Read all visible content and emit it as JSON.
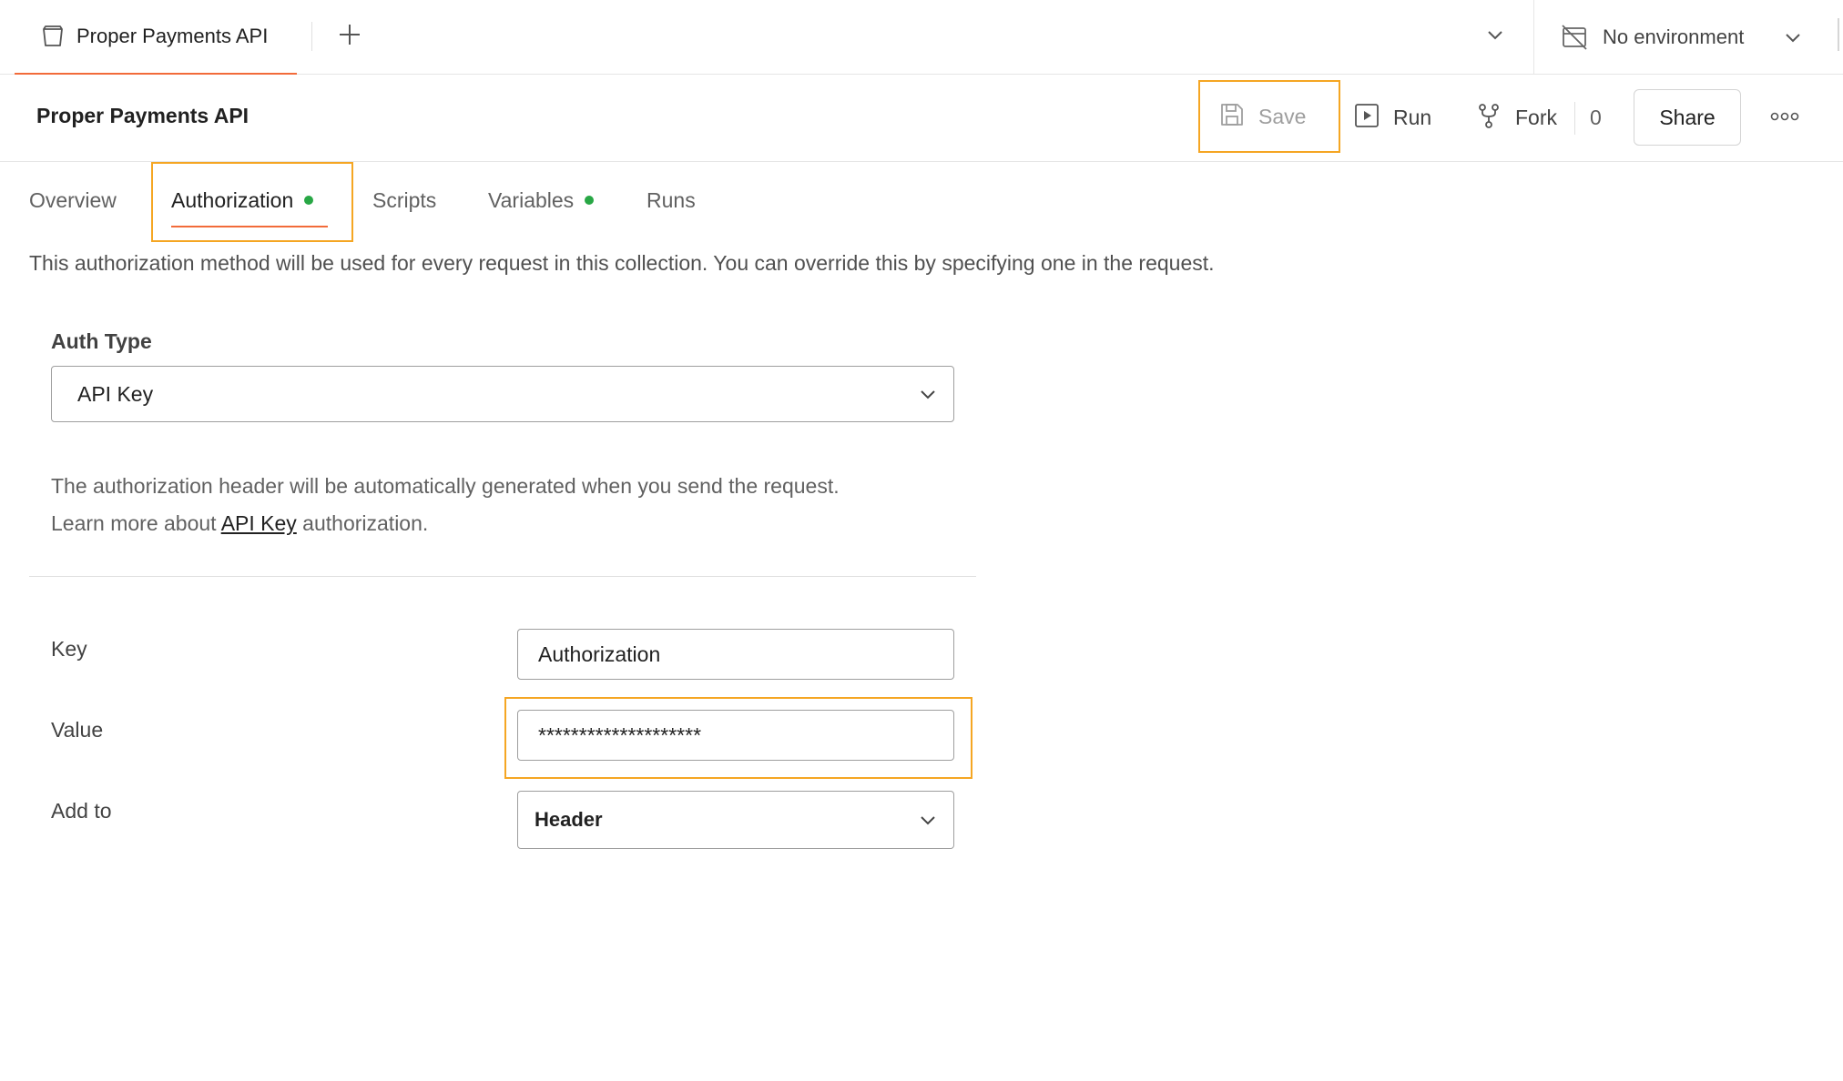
{
  "tab_bar": {
    "open_tab_title": "Proper Payments API",
    "environment_label": "No environment"
  },
  "header": {
    "collection_title": "Proper Payments API",
    "save_label": "Save",
    "run_label": "Run",
    "fork_label": "Fork",
    "fork_count": "0",
    "share_label": "Share"
  },
  "subtabs": [
    {
      "label": "Overview",
      "active": false,
      "dot": false
    },
    {
      "label": "Authorization",
      "active": true,
      "dot": true
    },
    {
      "label": "Scripts",
      "active": false,
      "dot": false
    },
    {
      "label": "Variables",
      "active": false,
      "dot": true
    },
    {
      "label": "Runs",
      "active": false,
      "dot": false
    }
  ],
  "description": "This authorization method will be used for every request in this collection. You can override this by specifying one in the request.",
  "auth": {
    "type_label": "Auth Type",
    "type_value": "API Key",
    "info_line1": "The authorization header will be automatically generated when you send the request.",
    "info_line2_prefix": "Learn more about ",
    "info_link": "API Key",
    "info_line2_suffix": " authorization.",
    "key_label": "Key",
    "key_value": "Authorization",
    "value_label": "Value",
    "value_masked": "********************",
    "add_to_label": "Add to",
    "add_to_value": "Header"
  },
  "colors": {
    "accent": "#f26b3a",
    "highlight": "#f5a623",
    "status_dot": "#28a745"
  },
  "icons": [
    "collection-icon",
    "plus-icon",
    "chevron-down-icon",
    "no-environment-icon",
    "save-icon",
    "run-icon",
    "fork-icon",
    "more-icon"
  ]
}
